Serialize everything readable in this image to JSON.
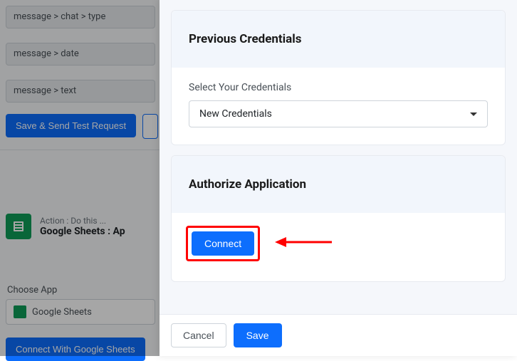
{
  "background": {
    "field1": "message > chat > type",
    "field2": "message > date",
    "field3": "message > text",
    "save_send_label": "Save & Send Test Request",
    "action_prefix": "Action : Do this ...",
    "action_app_line": "Google Sheets : Ap",
    "choose_app_label": "Choose App",
    "choose_app_value": "Google Sheets",
    "connect_with_label": "Connect With Google Sheets"
  },
  "panel": {
    "prev_cred_title": "Previous Credentials",
    "select_cred_label": "Select Your Credentials",
    "select_cred_value": "New Credentials",
    "authorize_title": "Authorize Application",
    "connect_label": "Connect",
    "cancel_label": "Cancel",
    "save_label": "Save"
  }
}
